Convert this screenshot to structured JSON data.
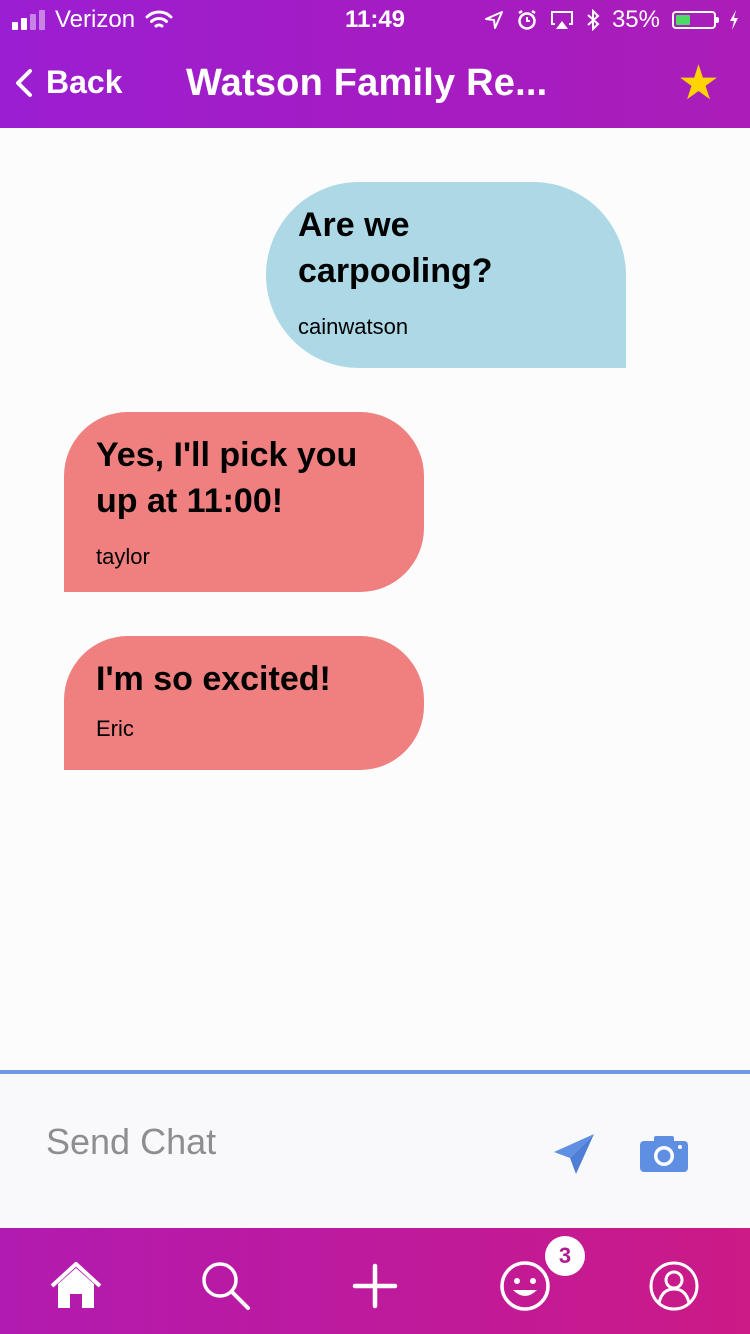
{
  "status": {
    "carrier": "Verizon",
    "time": "11:49",
    "battery_percent": "35%",
    "battery_level": 0.35
  },
  "header": {
    "back_label": "Back",
    "title": "Watson Family Re...",
    "favorite": true
  },
  "messages": [
    {
      "text": "Are we carpooling?",
      "author": "cainwatson",
      "direction": "sent",
      "color": "#add8e6"
    },
    {
      "text": "Yes, I'll pick you up at 11:00!",
      "author": "taylor",
      "direction": "received",
      "color": "#f08080"
    },
    {
      "text": "I'm so excited!",
      "author": "Eric",
      "direction": "received",
      "color": "#f08080"
    }
  ],
  "composer": {
    "placeholder": "Send Chat",
    "icons": [
      "send-icon",
      "camera-icon"
    ],
    "accent": "#6f98e5"
  },
  "tabbar": {
    "tabs": [
      "home-icon",
      "search-icon",
      "add-icon",
      "smiley-icon",
      "profile-icon"
    ],
    "badge_count": "3"
  },
  "colors": {
    "header": "#a01dc6",
    "tabbar": "#c01a99",
    "star": "#ffd400"
  }
}
